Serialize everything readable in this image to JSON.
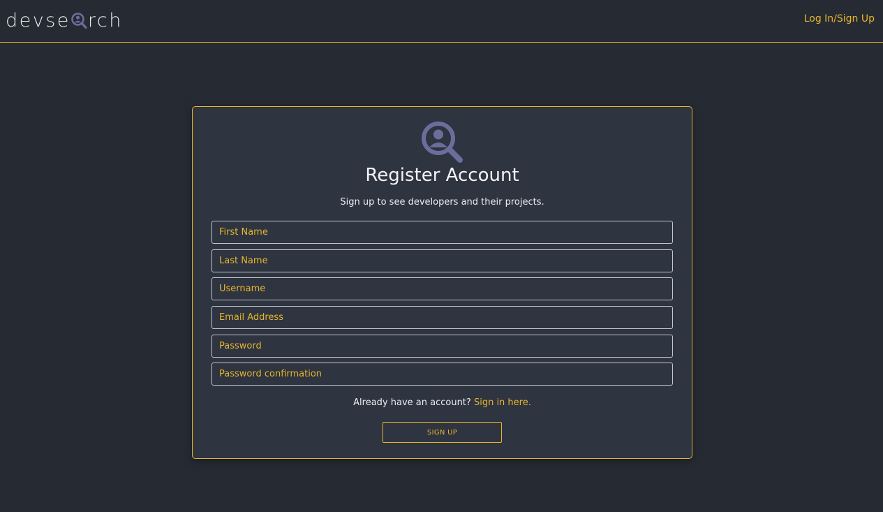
{
  "brand": {
    "logo_left": "devse",
    "logo_right": "rch",
    "logo_icon": "magnifier-user-icon"
  },
  "nav": {
    "login_label": "Log In/Sign Up"
  },
  "form": {
    "icon": "magnifier-user-icon",
    "title": "Register Account",
    "subtitle": "Sign up to see developers and their projects.",
    "fields": [
      {
        "placeholder": "First Name",
        "value": ""
      },
      {
        "placeholder": "Last Name",
        "value": ""
      },
      {
        "placeholder": "Username",
        "value": ""
      },
      {
        "placeholder": "Email Address",
        "value": ""
      },
      {
        "placeholder": "Password",
        "value": ""
      },
      {
        "placeholder": "Password confirmation",
        "value": ""
      }
    ],
    "signin_prompt": "Already have an account?",
    "signin_link": "Sign in here.",
    "submit_label": "SIGN UP"
  },
  "colors": {
    "background": "#262a33",
    "card": "#2e3440",
    "accent": "#e6b62e",
    "icon": "#6b6e9b",
    "text": "#f3f3f5"
  }
}
